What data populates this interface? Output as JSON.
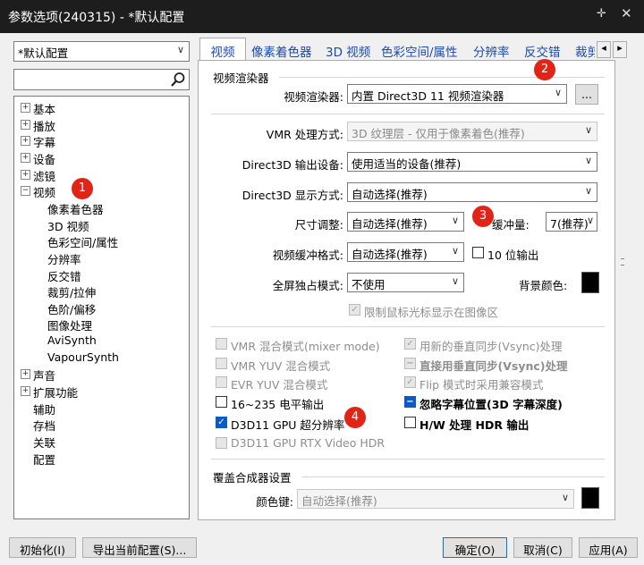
{
  "window": {
    "title": "参数选项(240315) - *默认配置",
    "pin_icon": "pin-icon",
    "close_icon": "close-icon"
  },
  "profile": {
    "value": "*默认配置"
  },
  "search": {
    "value": "",
    "icon": "magnifier-icon"
  },
  "tree": {
    "items": [
      {
        "label": "基本"
      },
      {
        "label": "播放"
      },
      {
        "label": "字幕"
      },
      {
        "label": "设备"
      },
      {
        "label": "滤镜"
      },
      {
        "label": "视频"
      },
      {
        "label": "像素着色器"
      },
      {
        "label": "3D 视频"
      },
      {
        "label": "色彩空间/属性"
      },
      {
        "label": "分辨率"
      },
      {
        "label": "反交错"
      },
      {
        "label": "裁剪/拉伸"
      },
      {
        "label": "色阶/偏移"
      },
      {
        "label": "图像处理"
      },
      {
        "label": "AviSynth"
      },
      {
        "label": "VapourSynth"
      },
      {
        "label": "声音"
      },
      {
        "label": "扩展功能"
      },
      {
        "label": "辅助"
      },
      {
        "label": "存档"
      },
      {
        "label": "关联"
      },
      {
        "label": "配置"
      }
    ]
  },
  "tabs": [
    {
      "label": "视频"
    },
    {
      "label": "像素着色器"
    },
    {
      "label": "3D 视频"
    },
    {
      "label": "色彩空间/属性"
    },
    {
      "label": "分辨率"
    },
    {
      "label": "反交错"
    },
    {
      "label": "裁剪"
    }
  ],
  "tab_scroll": {
    "left": "◂",
    "right": "▸"
  },
  "renderer": {
    "group_title": "视频渲染器",
    "renderer_label": "视频渲染器:",
    "renderer_value": "内置 Direct3D 11 视频渲染器",
    "more_button": "...",
    "vmr_label": "VMR 处理方式:",
    "vmr_value": "3D 纹理层 - 仅用于像素着色(推荐)",
    "d3d_device_label": "Direct3D 输出设备:",
    "d3d_device_value": "使用适当的设备(推荐)",
    "d3d_display_label": "Direct3D 显示方式:",
    "d3d_display_value": "自动选择(推荐)",
    "resize_label": "尺寸调整:",
    "resize_value": "自动选择(推荐)",
    "buffer_label": "缓冲量:",
    "buffer_value": "7(推荐)",
    "buffer_format_label": "视频缓冲格式:",
    "buffer_format_value": "自动选择(推荐)",
    "tenbit_label": "10 位输出",
    "fullscreen_label": "全屏独占模式:",
    "fullscreen_value": "不使用",
    "bgcolor_label": "背景颜色:",
    "cursor_label": "限制鼠标光标显示在图像区"
  },
  "options": {
    "vmr_mixer": "VMR 混合模式(mixer mode)",
    "vmr_yuv": "VMR YUV 混合模式",
    "evr_yuv": "EVR YUV 混合模式",
    "level_16_235": "16~235 电平输出",
    "d3d11_super_res": "D3D11 GPU 超分辨率",
    "d3d11_rtx_hdr": "D3D11 GPU RTX Video HDR",
    "vsync_new": "用新的垂直同步(Vsync)处理",
    "vsync_direct": "直接用垂直同步(Vsync)处理",
    "flip_compat": "Flip 模式时采用兼容模式",
    "ignore_sub_pos": "忽略字幕位置(3D 字幕深度)",
    "hw_hdr": "H/W 处理 HDR 输出"
  },
  "overlay": {
    "group_title": "覆盖合成器设置",
    "colorkey_label": "颜色键:",
    "colorkey_value": "自动选择(推荐)"
  },
  "badges": [
    "1",
    "2",
    "3",
    "4"
  ],
  "buttons": {
    "init": "初始化(I)",
    "export": "导出当前配置(S)...",
    "ok": "确定(O)",
    "cancel": "取消(C)",
    "apply": "应用(A)"
  },
  "colors": {
    "badge": "#e02418",
    "tab_text": "#1a49b0",
    "checked": "#0a5bc8"
  }
}
